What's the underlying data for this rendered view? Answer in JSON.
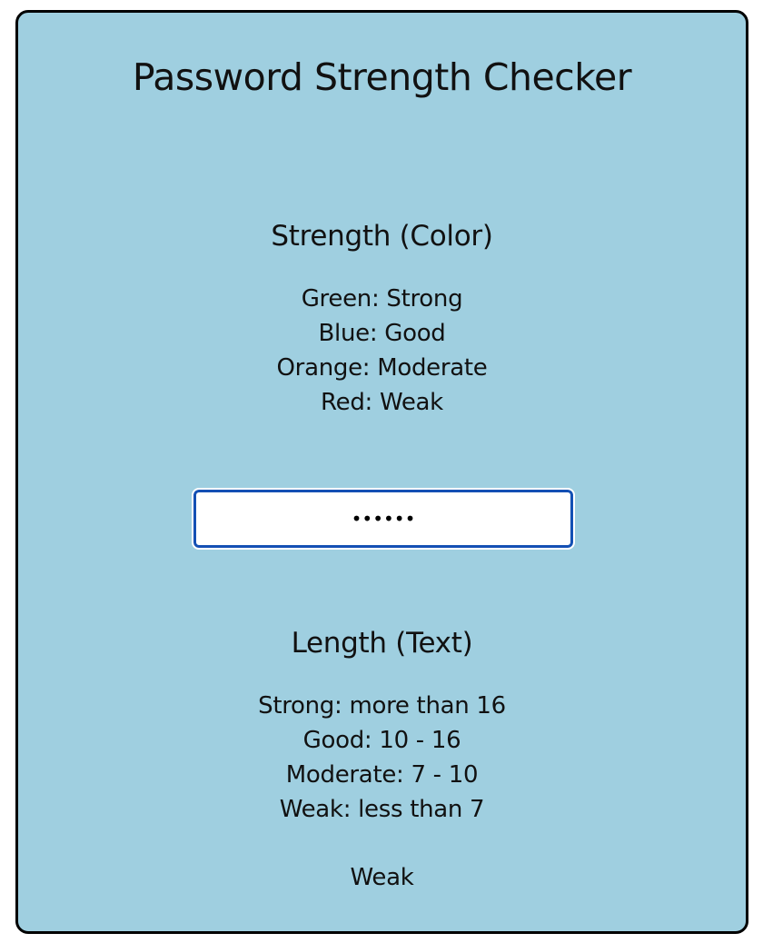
{
  "app": {
    "title": "Password Strength Checker"
  },
  "color_section": {
    "heading": "Strength (Color)",
    "items": [
      "Green: Strong",
      "Blue: Good",
      "Orange: Moderate",
      "Red: Weak"
    ]
  },
  "password_field": {
    "value": "••••••"
  },
  "length_section": {
    "heading": "Length (Text)",
    "items": [
      "Strong: more than 16",
      "Good: 10 - 16",
      "Moderate: 7 - 10",
      "Weak: less than 7"
    ]
  },
  "result": {
    "label": "Weak"
  },
  "colors": {
    "card_background": "#9fcfe0",
    "input_border": "#1450b4"
  }
}
